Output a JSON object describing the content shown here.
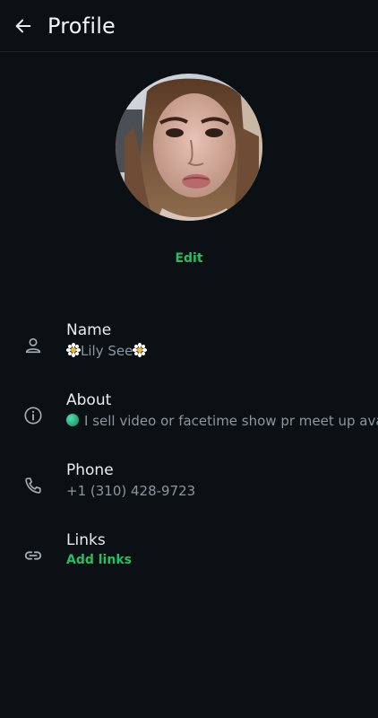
{
  "header": {
    "title": "Profile",
    "back_icon": "arrow-left-icon"
  },
  "avatar": {
    "icon": "profile-photo"
  },
  "edit_label": "Edit",
  "fields": [
    {
      "label": "Name",
      "value": "Lily See",
      "icon": "person-icon"
    },
    {
      "label": "About",
      "value": "I sell video or facetime show pr meet up available",
      "icon": "info-icon"
    },
    {
      "label": "Phone",
      "value": "+1 (310) 428-9723",
      "icon": "phone-icon"
    },
    {
      "label": "Links",
      "value": "Add links",
      "icon": "link-icon"
    }
  ],
  "colors": {
    "background": "#0b1014",
    "accent": "#21c063",
    "secondary_text": "#8b979e"
  }
}
